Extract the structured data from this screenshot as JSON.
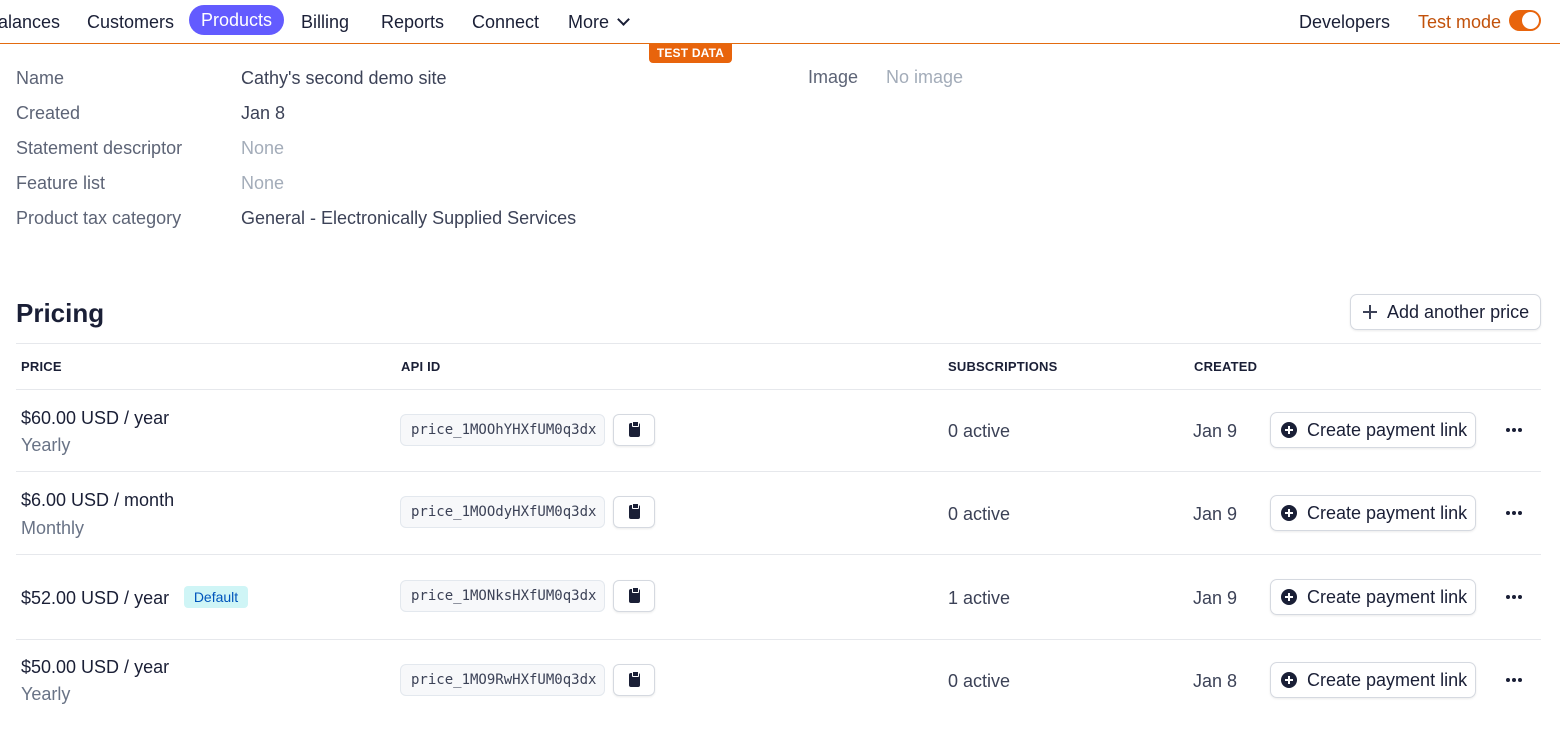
{
  "nav": {
    "items": [
      "alances",
      "Customers",
      "Products",
      "Billing",
      "Reports",
      "Connect",
      "More"
    ],
    "developers": "Developers",
    "test_mode": "Test mode",
    "test_data_badge": "TEST DATA"
  },
  "details": {
    "name_label": "Name",
    "name_value": "Cathy's second demo site",
    "created_label": "Created",
    "created_value": "Jan 8",
    "descriptor_label": "Statement descriptor",
    "descriptor_value": "None",
    "feature_label": "Feature list",
    "feature_value": "None",
    "tax_label": "Product tax category",
    "tax_value": "General - Electronically Supplied Services",
    "image_label": "Image",
    "image_value": "No image"
  },
  "pricing": {
    "title": "Pricing",
    "add_button": "Add another price",
    "headers": {
      "price": "PRICE",
      "api_id": "API ID",
      "subscriptions": "SUBSCRIPTIONS",
      "created": "CREATED"
    },
    "rows": [
      {
        "price": "$60.00 USD / year",
        "interval": "Yearly",
        "badge": "",
        "api_id": "price_1MOOhYHXfUM0q3dx",
        "subscriptions": "0 active",
        "created": "Jan 9",
        "action": "Create payment link"
      },
      {
        "price": "$6.00 USD / month",
        "interval": "Monthly",
        "badge": "",
        "api_id": "price_1MOOdyHXfUM0q3dx",
        "subscriptions": "0 active",
        "created": "Jan 9",
        "action": "Create payment link"
      },
      {
        "price": "$52.00 USD / year",
        "interval": "",
        "badge": "Default",
        "api_id": "price_1MONksHXfUM0q3dx",
        "subscriptions": "1 active",
        "created": "Jan 9",
        "action": "Create payment link"
      },
      {
        "price": "$50.00 USD / year",
        "interval": "Yearly",
        "badge": "",
        "api_id": "price_1MO9RwHXfUM0q3dx",
        "subscriptions": "0 active",
        "created": "Jan 8",
        "action": "Create payment link"
      }
    ]
  },
  "colors": {
    "accent": "#635bff",
    "test_mode": "#e8640c",
    "default_badge_bg": "#cff5f6"
  }
}
